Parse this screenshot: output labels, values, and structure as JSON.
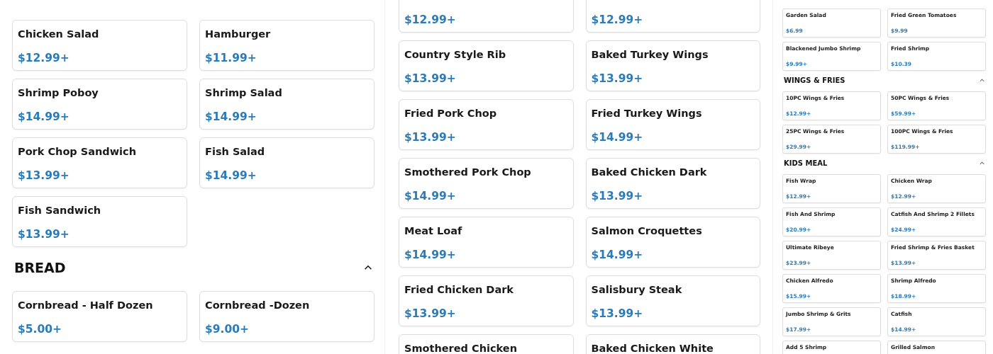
{
  "panels": [
    {
      "kind": "regular",
      "sections": [
        {
          "items": [
            {
              "name": "Chicken Salad",
              "price": "$12.99+"
            },
            {
              "name": "Hamburger",
              "price": "$11.99+"
            },
            {
              "name": "Shrimp Poboy",
              "price": "$14.99+"
            },
            {
              "name": "Shrimp Salad",
              "price": "$14.99+"
            },
            {
              "name": "Pork Chop Sandwich",
              "price": "$13.99+"
            },
            {
              "name": "Fish Salad",
              "price": "$14.99+"
            },
            {
              "name": "Fish Sandwich",
              "price": "$13.99+"
            }
          ]
        },
        {
          "title": "BREAD",
          "expanded": true,
          "items": [
            {
              "name": "Cornbread - Half Dozen",
              "price": "$5.00+"
            },
            {
              "name": "Cornbread -Dozen",
              "price": "$9.00+"
            }
          ]
        }
      ]
    },
    {
      "kind": "regular",
      "sections": [
        {
          "items": [
            {
              "price": "$12.99+"
            },
            {
              "price": "$12.99+"
            },
            {
              "name": "Country Style Rib",
              "price": "$13.99+"
            },
            {
              "name": "Baked Turkey Wings",
              "price": "$13.99+"
            },
            {
              "name": "Fried Pork Chop",
              "price": "$13.99+"
            },
            {
              "name": "Fried Turkey Wings",
              "price": "$14.99+"
            },
            {
              "name": "Smothered Pork Chop",
              "price": "$14.99+"
            },
            {
              "name": "Baked Chicken Dark",
              "price": "$13.99+"
            },
            {
              "name": "Meat Loaf",
              "price": "$14.99+"
            },
            {
              "name": "Salmon Croquettes",
              "price": "$14.99+"
            },
            {
              "name": "Fried Chicken Dark",
              "price": "$13.99+"
            },
            {
              "name": "Salisbury Steak",
              "price": "$13.99+"
            },
            {
              "name": "Smothered Chicken"
            },
            {
              "name": "Baked Chicken White"
            }
          ]
        }
      ]
    },
    {
      "kind": "compact",
      "sections": [
        {
          "items": [
            {
              "name": "Garden Salad",
              "price": "$6.99"
            },
            {
              "name": "Fried Green Tomatoes",
              "price": "$9.99"
            },
            {
              "name": "Blackened Jumbo Shrimp",
              "price": "$9.99+"
            },
            {
              "name": "Fried Shrimp",
              "price": "$10.39"
            }
          ]
        },
        {
          "title": "WINGS & FRIES",
          "expanded": true,
          "items": [
            {
              "name": "10PC Wings & Fries",
              "price": "$12.99+"
            },
            {
              "name": "50PC Wings & Fries",
              "price": "$59.99+"
            },
            {
              "name": "25PC Wings & Fries",
              "price": "$29.99+"
            },
            {
              "name": "100PC Wings & Fries",
              "price": "$119.99+"
            }
          ]
        },
        {
          "title": "KIDS MEAL",
          "expanded": true,
          "items": [
            {
              "name": "Fish Wrap",
              "price": "$12.99+"
            },
            {
              "name": "Chicken Wrap",
              "price": "$12.99+"
            },
            {
              "name": "Fish And Shrimp",
              "price": "$20.99+"
            },
            {
              "name": "Catfish And Shrimp 2 Fillets",
              "price": "$24.99+"
            },
            {
              "name": "Ultimate Ribeye",
              "price": "$23.99+"
            },
            {
              "name": "Fried Shrimp & Fries Basket",
              "price": "$13.99+"
            },
            {
              "name": "Chicken Alfredo",
              "price": "$15.99+"
            },
            {
              "name": "Shrimp Alfredo",
              "price": "$18.99+"
            },
            {
              "name": "Jumbo Shrimp & Grits",
              "price": "$17.99+"
            },
            {
              "name": "Catfish",
              "price": "$14.99+"
            },
            {
              "name": "Add 5 Shrimp"
            },
            {
              "name": "Grilled Salmon"
            }
          ]
        }
      ]
    }
  ]
}
